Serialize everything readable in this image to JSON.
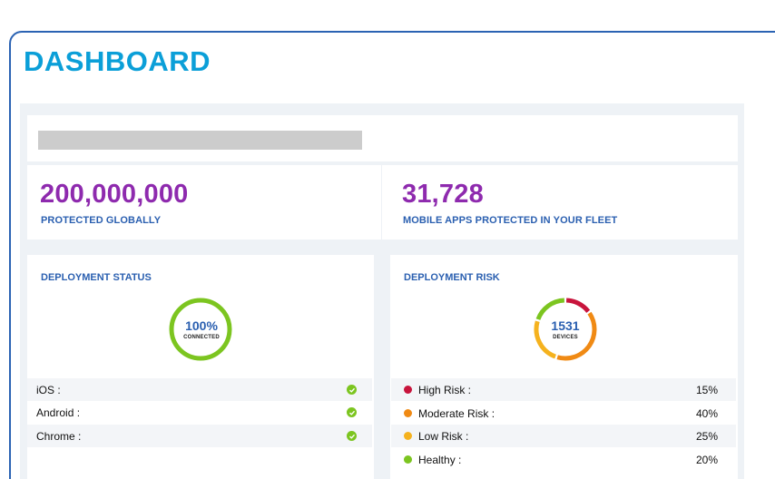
{
  "header": {
    "title": "DASHBOARD"
  },
  "stats": {
    "protected": {
      "value": "200,000,000",
      "label": "PROTECTED GLOBALLY"
    },
    "apps": {
      "value": "31,728",
      "label": "MOBILE APPS PROTECTED IN YOUR FLEET"
    }
  },
  "deployment_status": {
    "title": "DEPLOYMENT STATUS",
    "ring": {
      "value": "100%",
      "label": "CONNECTED",
      "fraction": 1.0,
      "color": "#7cc520"
    },
    "items": [
      {
        "label": "iOS :",
        "icon": "check-circle-icon"
      },
      {
        "label": "Android :",
        "icon": "check-circle-icon"
      },
      {
        "label": "Chrome :",
        "icon": "check-circle-icon"
      }
    ]
  },
  "deployment_risk": {
    "title": "DEPLOYMENT RISK",
    "ring": {
      "value": "1531",
      "label": "DEVICES"
    },
    "items": [
      {
        "label": "High Risk :",
        "percent": "15%",
        "color": "#c8143c"
      },
      {
        "label": "Moderate Risk :",
        "percent": "40%",
        "color": "#f08a14"
      },
      {
        "label": "Low Risk :",
        "percent": "25%",
        "color": "#f5b21e"
      },
      {
        "label": "Healthy :",
        "percent": "20%",
        "color": "#7cc520"
      }
    ]
  }
}
